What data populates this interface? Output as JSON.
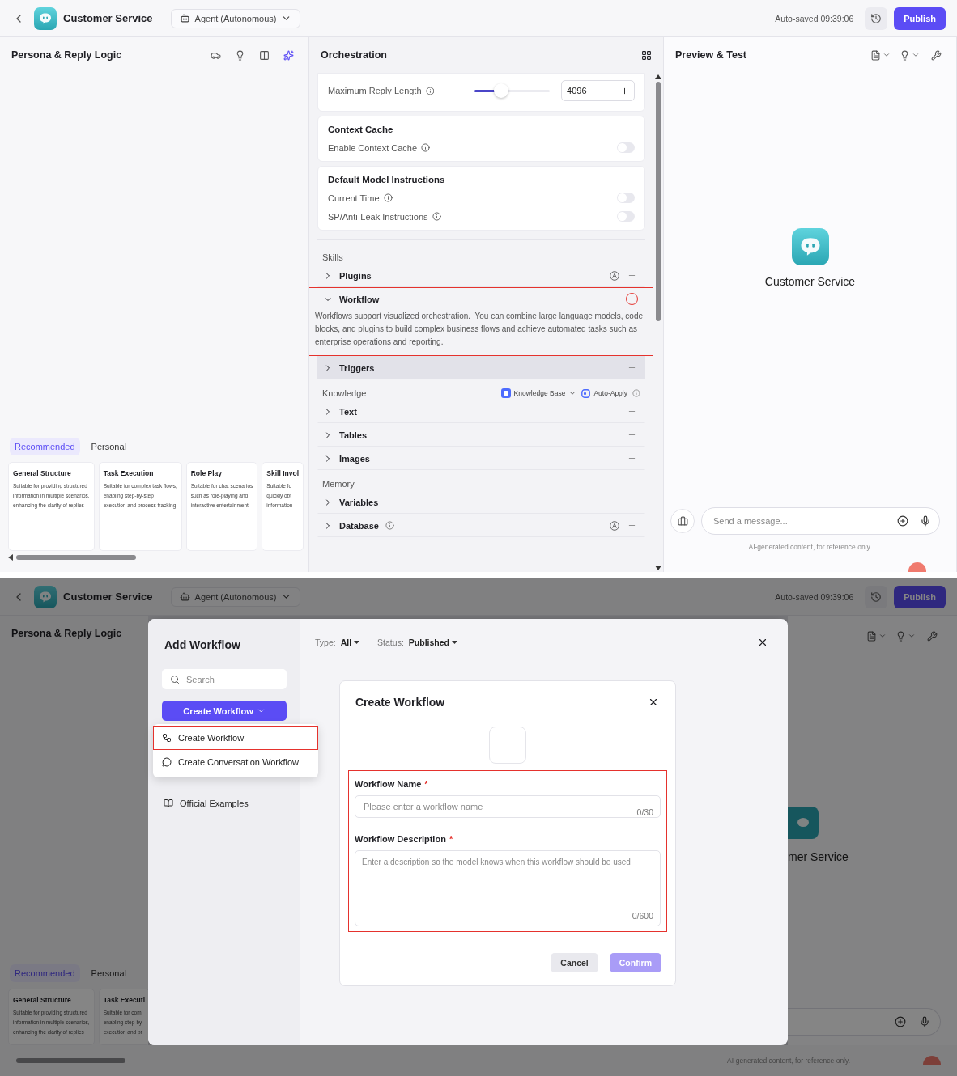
{
  "top": {
    "header": {
      "title": "Customer Service",
      "mode": "Agent (Autonomous)",
      "autosave": "Auto-saved 09:39:06",
      "publish": "Publish"
    },
    "persona": {
      "title": "Persona & Reply Logic",
      "tabs": [
        {
          "label": "Recommended",
          "selected": true
        },
        {
          "label": "Personal",
          "selected": false
        }
      ],
      "cards": [
        {
          "title": "General Structure",
          "lines": [
            "Suitable for providing structured",
            "information in multiple scenarios,",
            "enhancing the clarity of replies"
          ]
        },
        {
          "title": "Task Execution",
          "lines": [
            "Suitable for complex task flows,",
            "enabling step-by-step",
            "execution and process tracking"
          ]
        },
        {
          "title": "Role Play",
          "lines": [
            "Suitable for chat scenarios",
            "such as role-playing and",
            "interactive entertainment"
          ]
        },
        {
          "title": "Skill Invol",
          "lines": [
            "Suitable fo",
            "quickly obt",
            "information"
          ]
        }
      ]
    },
    "orchestration": {
      "title": "Orchestration",
      "reply_length": {
        "label": "Maximum Reply Length",
        "level": 0.35,
        "value": "4096"
      },
      "setting_cards": [
        {
          "title": "Context Cache",
          "toggles": [
            {
              "label": "Enable Context Cache",
              "on": false
            }
          ]
        },
        {
          "title": "Default Model Instructions",
          "toggles": [
            {
              "label": "Current Time",
              "on": false
            },
            {
              "label": "SP/Anti-Leak Instructions",
              "on": false
            }
          ]
        }
      ],
      "groups": [
        {
          "title": "Skills",
          "items": [
            {
              "label": "Plugins",
              "expanded": false,
              "highlighted": false,
              "hovered": false,
              "auto": true,
              "info": false
            },
            {
              "label": "Workflow",
              "expanded": true,
              "highlighted": true,
              "hovered": false,
              "auto": false,
              "info": false,
              "description": "Workflows support visualized orchestration.  You can combine large language models, code blocks, and plugins to build complex business flows and achieve automated tasks such as enterprise operations and reporting."
            },
            {
              "label": "Triggers",
              "expanded": false,
              "highlighted": false,
              "hovered": true,
              "auto": false,
              "info": false
            }
          ]
        },
        {
          "title": "Knowledge",
          "controls": {
            "source": "Knowledge Base",
            "mode": "Auto-Apply"
          },
          "items": [
            {
              "label": "Text",
              "expanded": false,
              "highlighted": false,
              "hovered": false,
              "auto": false,
              "info": false
            },
            {
              "label": "Tables",
              "expanded": false,
              "highlighted": false,
              "hovered": false,
              "auto": false,
              "info": false
            },
            {
              "label": "Images",
              "expanded": false,
              "highlighted": false,
              "hovered": false,
              "auto": false,
              "info": false
            }
          ]
        },
        {
          "title": "Memory",
          "items": [
            {
              "label": "Variables",
              "expanded": false,
              "highlighted": false,
              "hovered": false,
              "auto": false,
              "info": false
            },
            {
              "label": "Database",
              "expanded": false,
              "highlighted": false,
              "hovered": false,
              "auto": true,
              "info": true
            }
          ]
        }
      ]
    },
    "preview": {
      "title": "Preview & Test",
      "bot_name": "Customer Service",
      "placeholder": "Send a message...",
      "disclaimer": "AI-generated content, for reference only."
    }
  },
  "bottom": {
    "header": {
      "title": "Customer Service",
      "mode": "Agent (Autonomous)",
      "autosave": "Auto-saved 09:39:06",
      "publish": "Publish"
    },
    "persona": {
      "title": "Persona & Reply Logic",
      "tabs": [
        {
          "label": "Recommended",
          "selected": true
        },
        {
          "label": "Personal",
          "selected": false
        }
      ],
      "cards": [
        {
          "title": "General Structure",
          "lines": [
            "Suitable for providing structured",
            "information in multiple scenarios,",
            "enhancing the clarity of replies"
          ]
        },
        {
          "title": "Task Executi",
          "lines": [
            "Suitable for com",
            "enabling step-by-",
            "execution and pr"
          ]
        }
      ]
    },
    "preview": {
      "bot_name": "mer Service",
      "disclaimer": "AI-generated content, for reference only."
    },
    "modal": {
      "title": "Add Workflow",
      "search_placeholder": "Search",
      "create_button": "Create Workflow",
      "menu": [
        {
          "kind": "workflow",
          "label": "Create Workflow",
          "highlighted": true
        },
        {
          "kind": "conversation",
          "label": "Create Conversation Workflow",
          "highlighted": false
        }
      ],
      "examples": "Official Examples",
      "filters": [
        {
          "label": "Type:",
          "value": "All"
        },
        {
          "label": "Status:",
          "value": "Published"
        }
      ],
      "dialog": {
        "title": "Create Workflow",
        "fields_highlighted": true,
        "fields": [
          {
            "kind": "input",
            "label": "Workflow Name",
            "required_mark": "*",
            "placeholder": "Please enter a workflow name",
            "count": "0/30"
          },
          {
            "kind": "textarea",
            "label": "Workflow Description",
            "required_mark": "*",
            "placeholder": "Enter a description so the model knows when this workflow should be used",
            "count": "0/600"
          }
        ],
        "cancel": "Cancel",
        "confirm": "Confirm",
        "confirm_disabled": true
      }
    }
  }
}
